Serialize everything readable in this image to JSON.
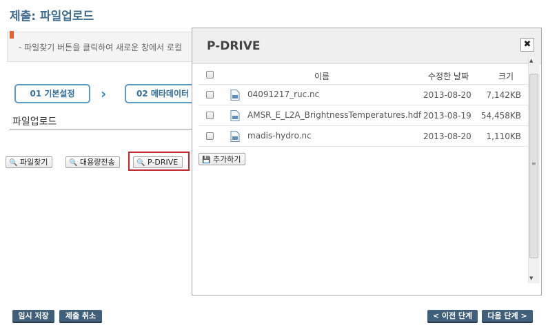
{
  "page": {
    "title": "제출: 파일업로드",
    "notice": "- 파일찾기 버튼을 클릭하여 새로운 창에서 로컬"
  },
  "steps": [
    {
      "label": "01 기본설정"
    },
    {
      "label": "02 메타데이터"
    }
  ],
  "section_label": "파일업로드",
  "upload_buttons": {
    "find_file": "파일찾기",
    "bulk_transfer": "대용량전송",
    "pdrive": "P-DRIVE"
  },
  "footer": {
    "temp_save": "임시 저장",
    "cancel_submit": "제출 취소",
    "prev_step": "< 이전 단계",
    "next_step": "다음 단계 >"
  },
  "modal": {
    "title": "P-DRIVE",
    "close_icon": "close-icon",
    "columns": {
      "name": "이름",
      "modified": "수정한 날짜",
      "size": "크기"
    },
    "files": [
      {
        "name": "04091217_ruc.nc",
        "modified": "2013-08-20",
        "size": "7,142KB"
      },
      {
        "name": "AMSR_E_L2A_BrightnessTemperatures.hdf",
        "modified": "2013-08-19",
        "size": "54,458KB"
      },
      {
        "name": "madis-hydro.nc",
        "modified": "2013-08-20",
        "size": "1,110KB"
      }
    ],
    "add_button": "추가하기"
  },
  "colors": {
    "accent": "#3e6d91",
    "highlight": "#c1272d",
    "dark_button": "#3f5f7a"
  }
}
